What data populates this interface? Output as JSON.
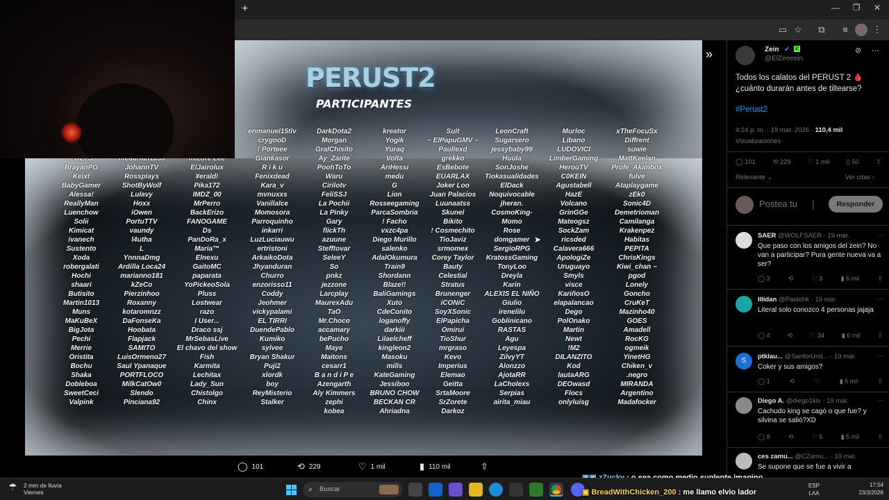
{
  "browser": {
    "new_tab": "+",
    "minimize": "—",
    "restore": "❐",
    "close": "✕"
  },
  "poster": {
    "title": "PERUST2",
    "subtitle": "PARTICIPANTES",
    "columns": [
      [
        "POLYS",
        "BrayanPG",
        "Keixt",
        "BabyGamer",
        "Alessa!",
        "ReallyMan",
        "Luenchow",
        "Solii",
        "Kimicat",
        "ivanech",
        "Sustento",
        "Xoda",
        "robergalati",
        "Hochi",
        "shaari",
        "Butisito",
        "Martin1013",
        "Muns",
        "MaKuBeX",
        "BigJota",
        "Pechi",
        "Merrie",
        "Oristita",
        "Bochu",
        "Shaka",
        "Dobleboa",
        "SweetCeci",
        "Valpink"
      ],
      [
        "theadrian1033",
        "JohannTV",
        "Rossplays",
        "ShotByWolf",
        "Lulavy",
        "Hoxx",
        "iOwen",
        "PortuTTV",
        "vaundy",
        "l4utha",
        "L",
        "YnnnaDmg",
        "Ardilla Loca24",
        "marianno181",
        "kZeCo",
        "Pierzinhoo",
        "Roxanny",
        "kotaromnzz",
        "DaFonseKa",
        "Hoobata",
        "Flapjack",
        "SAMITO",
        "LuisOrmeno27",
        "Saul Ypanaque",
        "PORTFLOCO",
        "MilkCatOw0",
        "Slendo",
        "Pinciana92"
      ],
      [
        "mizore Lee",
        "ElJairolux",
        "¥erald!",
        "Pika172",
        "IMDZ_00",
        "MrPerro",
        "BackErizo",
        "FANOGAME",
        "Ds",
        "PanDoRa_x",
        "Maria™",
        "Elnexu",
        "GaitoMC",
        "paparata",
        "YoPickeoSola",
        "Pluss",
        "Lostwear",
        "razo",
        "I User...",
        "Draco ssj",
        "MrSebasLive",
        "El chavo del show",
        "Fish",
        "Karmita",
        "Lechitax",
        "Lady_Sun",
        "Chistolgo",
        "Chinx"
      ],
      [
        "enmanuel15tlv",
        "crygooD",
        "! Porteee",
        "Giankasor",
        "R i k u",
        "Fenixdead",
        "Kara_v",
        "mvnuxxs",
        "Vanillalce",
        "Momosora",
        "Parroquinho",
        "inkarri",
        "LuzLuciauwu",
        "ertristoni",
        "ArkaikoDota",
        "Jhyanduran",
        "Churro",
        "enzorisso11",
        "Coddy",
        "Jeohmer",
        "vickypalami",
        "EL TIRRI",
        "DuendePablo",
        "Kumiko",
        "sylvee",
        "Bryan Shakur",
        "Puji2",
        "xlordk",
        "boy",
        "ReyMisterio",
        "Stalker"
      ],
      [
        "DarkDota2",
        "Morgan",
        "GralChisito",
        "Ay_Zarite",
        "PoohToTo",
        "Waru",
        "Cirilotv",
        "FeliSSJ",
        "La Pochii",
        "La Pinky",
        "Gary",
        "flickTh",
        "azuune",
        "Stefftovar",
        "SeleeY",
        "So",
        "pnkz",
        "jezzone",
        "Larcplay",
        "MaurexAdu",
        "TaO",
        "Mr.Choco",
        "accamary",
        "bePucho",
        "Maye",
        "Maitons",
        "cesarr1",
        "B a n d i P e",
        "Azengarth",
        "Aly Kimmers",
        "zephi",
        "kobea"
      ],
      [
        "kreator",
        "Yogik",
        "Yuraq",
        "Volta",
        "AriHessi",
        "medu",
        "G",
        "Lion",
        "Rosseegaming",
        "ParcaSombria",
        "! Facho",
        "vxzc4pa",
        "Diego Murillo",
        "salenko",
        "AdalOkumura",
        "Train9",
        "Shordann",
        "Blaze!!",
        "BaliGamings",
        "Xuto",
        "CdeConito",
        "loganoffy",
        "darkiii",
        "Lilaelcheff",
        "kingleon2",
        "Masoku",
        "mills",
        "KateGaming",
        "Jessiboo",
        "BRUNO CHOW",
        "BECKAN CR",
        "Ahriadna"
      ],
      [
        "Suit",
        "~ ElPapuGMV ~",
        "Paullexd",
        "grekko",
        "EsBebote",
        "EUARLAX",
        "Joker Loo",
        "Juan Palacios",
        "Luunaatss",
        "Skunel",
        "Bikito",
        "! Cosmechito",
        "TioJaviz",
        "srmomex",
        "Corey Taylor",
        "Bauty",
        "Celestial",
        "Stratus",
        "Brunenger",
        "iCONiC",
        "SoyXSonic",
        "ElPapicha",
        "Omirui",
        "TioShur",
        "mrgraso",
        "Kevo",
        "Imperius",
        "Elemao",
        "Geitta",
        "SrtaMoore",
        "SrZorete",
        "Darkoz"
      ],
      [
        "LeonCraft",
        "Sugarsero",
        "jessybaby99",
        "Huula",
        "SonJoshe",
        "Tiokasualidades",
        "ElDack",
        "Noquivocable",
        "jheran.",
        "CosmoKing-",
        "Momo",
        "Rose",
        "domgamer",
        "SergioRPG",
        "KratossGaming",
        "TonyLoo",
        "Dreyla",
        "Karin",
        "ALEXIS EL NIÑO",
        "Giulio",
        "irenelilu",
        "Goblinicano",
        "RASTAS",
        "Agu",
        "Leyespa",
        "ZilvyYT",
        "Alonzzo",
        "AjotaRR",
        "LaCholexs",
        "Serpias",
        "airita_miau"
      ],
      [
        "Murloc",
        "Libano",
        "LUDOVICI",
        "LimberGaming",
        "HerouTV",
        "C0KEIN",
        "Agustabell",
        "HazE",
        "Volcano",
        "GrinGGe",
        "Mateogsz",
        "SockZam",
        "ricsded",
        "Calavera666",
        "ApologiZe",
        "Uruguayo",
        "Smyls",
        "visce",
        "KariñosO",
        "elapalancao",
        "Dego",
        "PolOnako",
        "Martin",
        "Newt",
        "!M2",
        "DILANZITO",
        "Kod",
        "lautaARG",
        "DEOwasd",
        "Flocs",
        "onlyluisg"
      ],
      [
        "xTheFocuSx",
        "Diffrent",
        "suwie",
        "MattKeelan",
        "Profe_Akimbox",
        "fulve",
        "Ataplaygame",
        "zEk0",
        "Sonic4D",
        "Demetrioman",
        "Camilanga",
        "Krakenpez",
        "Habitas",
        "PEPITA",
        "ChrisKings",
        "Kiwi_chan ~",
        "pgod",
        "Lonely",
        "Goncho",
        "CruKeT",
        "Mazinho40",
        "GOES",
        "Amadell",
        "RocKG",
        "ogmeik",
        "YinetHG",
        "Chiken_v",
        ".negro",
        "MIRANDA",
        "Argentino",
        "Madafocker"
      ]
    ]
  },
  "viewer_actions": {
    "replies": "101",
    "reposts": "229",
    "likes": "1 mil",
    "views": "110 mil"
  },
  "tweet": {
    "name": "Zein",
    "handle": "@ElZeeeein",
    "text": "Todos los calatos del PERUST 2 🩸 ¿cuánto durarán antes de tiltearse?",
    "hashtag": "#Perust2",
    "time": "4:24 p. m. · 19 mar. 2026 · ",
    "views_count": "110,4 mil",
    "views_label": "Visualizaciones",
    "replies": "101",
    "reposts": "229",
    "likes": "1 mil",
    "bookmarks": "50",
    "sort_label": "Relevante",
    "quotes_link": "Ver citas",
    "reply_placeholder": "Postea tu",
    "reply_button": "Responder"
  },
  "comments": [
    {
      "name": "SAER",
      "handle": "@WOLFSAER",
      "date": "· 19 mar.",
      "text": "Que paso con los amigos del zein? No van a participar? Pura gente nueva va a ser?",
      "replies": "3",
      "likes": "3",
      "views": "6 mil"
    },
    {
      "name": "Illidan",
      "handle": "@Paolohk",
      "date": "· 19 mar.",
      "text": "Literal solo conozco 4 personas jajaja",
      "replies": "4",
      "likes": "34",
      "views": "6 mil"
    },
    {
      "name": "ptklau...",
      "handle": "@SanforUnd...",
      "date": "· 19 mar.",
      "text": "Coker y sus amigos?",
      "replies": "1",
      "likes": "",
      "views": "5 mil"
    },
    {
      "name": "Diego A.",
      "handle": "@diego1klv",
      "date": "· 19 mar.",
      "text": "Cachudo king se cagó o que fue? y silvina se salió?XD",
      "replies": "8",
      "likes": "5",
      "views": "5 mil"
    },
    {
      "name": "ces zamu...",
      "handle": "@CZamu...",
      "date": "· 19 mar.",
      "text": "Se supone que se fue a vivir a",
      "replies": "",
      "likes": "",
      "views": ""
    }
  ],
  "chat": [
    {
      "user": "zZucky",
      "message": ": o sea como medio suplente imagino"
    },
    {
      "user": "BreadWithChicken_200",
      "message": ": me llamo elvio lador"
    }
  ],
  "taskbar": {
    "weather_text": "2 mm de lluvia",
    "weather_day": "Viernes",
    "search_placeholder": "Buscar",
    "lang1": "ESP",
    "lang2": "LAA",
    "time": "17:54",
    "date": "23/3/2026"
  }
}
